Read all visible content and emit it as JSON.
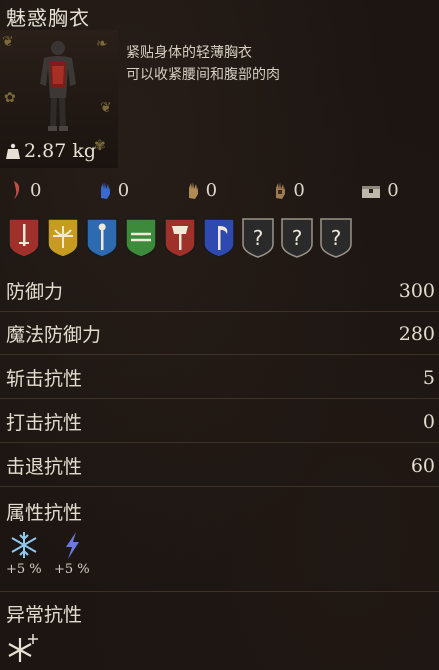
{
  "item": {
    "name": "魅惑胸衣",
    "weight": "2.87 kg",
    "description_lines": [
      "紧贴身体的轻薄胸衣",
      "可以收紧腰间和腹部的肉"
    ]
  },
  "durability": [
    {
      "icon": "slash-durability-icon",
      "value": "0",
      "color": "#c0504a"
    },
    {
      "icon": "magic-durability-icon",
      "value": "0",
      "color": "#3a6ad0"
    },
    {
      "icon": "hand-durability-icon",
      "value": "0",
      "color": "#b08a55"
    },
    {
      "icon": "gauntlet-durability-icon",
      "value": "0",
      "color": "#a07a50"
    },
    {
      "icon": "chest-durability-icon",
      "value": "0",
      "color": "#bfb8aa"
    }
  ],
  "weapon_shields": [
    {
      "name": "dagger-shield-icon",
      "color": "#a0302a"
    },
    {
      "name": "crossbow-shield-icon",
      "color": "#c79a20"
    },
    {
      "name": "staff-shield-icon",
      "color": "#2e6ab0"
    },
    {
      "name": "twin-blade-shield-icon",
      "color": "#3d8a3a"
    },
    {
      "name": "axe-shield-icon",
      "color": "#a0302a"
    },
    {
      "name": "scythe-shield-icon",
      "color": "#2e4ab0"
    },
    {
      "name": "unknown-shield-icon",
      "color": "#2a2a2a",
      "label": "?"
    },
    {
      "name": "unknown-shield-icon",
      "color": "#2a2a2a",
      "label": "?"
    },
    {
      "name": "unknown-shield-icon",
      "color": "#2a2a2a",
      "label": "?"
    }
  ],
  "stats": [
    {
      "label": "防御力",
      "value": "300"
    },
    {
      "label": "魔法防御力",
      "value": "280"
    },
    {
      "label": "斩击抗性",
      "value": "5"
    },
    {
      "label": "打击抗性",
      "value": "0"
    },
    {
      "label": "击退抗性",
      "value": "60"
    }
  ],
  "attribute_resist": {
    "label": "属性抗性",
    "items": [
      {
        "icon": "frost-icon",
        "value": "+5 %"
      },
      {
        "icon": "lightning-icon",
        "value": "+5 %"
      }
    ]
  },
  "status_resist": {
    "label": "异常抗性",
    "items": [
      {
        "icon": "frost-burst-icon"
      }
    ]
  }
}
